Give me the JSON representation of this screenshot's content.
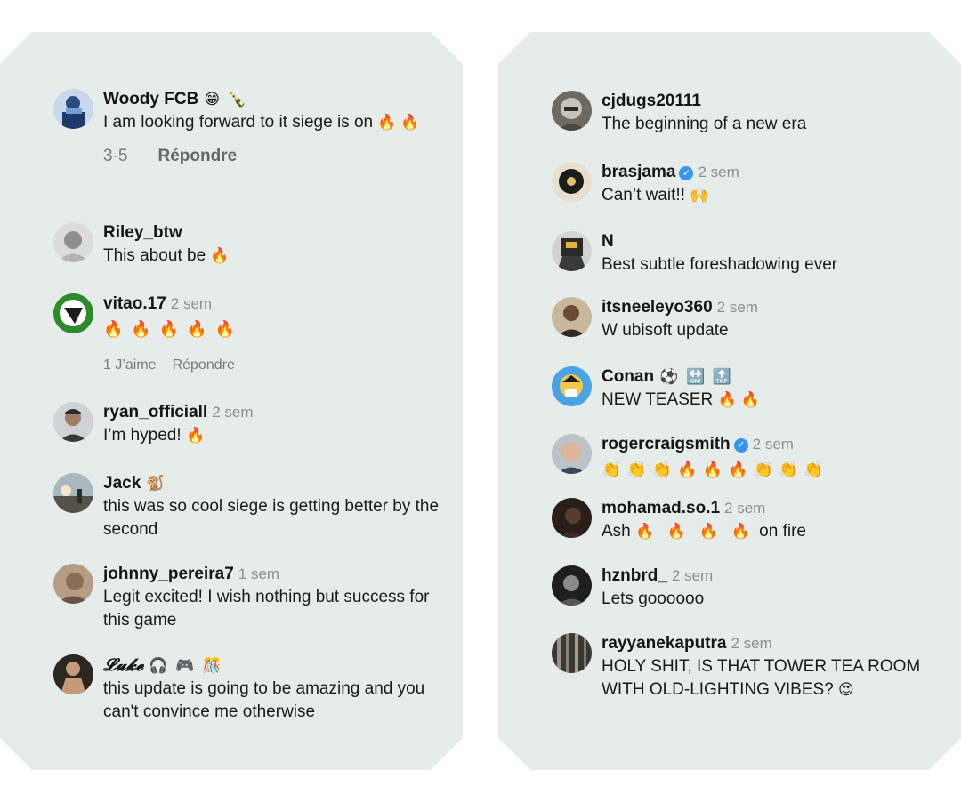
{
  "left_comments": [
    {
      "user": "Woody FCB",
      "time": "",
      "emojis": "😁 🍾",
      "text": "I am looking forward to it siege is on",
      "text_emoji": "🔥 🔥",
      "actions": {
        "date": "3-5",
        "reply": "Répondre"
      }
    },
    {
      "user": "Riley_btw",
      "time": "",
      "emojis": "",
      "text": "This about be",
      "text_emoji": "🔥"
    },
    {
      "user": "vitao.17",
      "time": "2 sem",
      "emojis": "",
      "text": "",
      "text_emoji": "🔥🔥🔥🔥🔥",
      "actions": {
        "likes": "1 J’aime",
        "reply": "Répondre"
      }
    },
    {
      "user": "ryan_officiall",
      "time": "2 sem",
      "emojis": "",
      "text": "I’m hyped!",
      "text_emoji": "🔥"
    },
    {
      "user": "Jack",
      "time": "",
      "emojis": "🐒",
      "text": "this was so cool siege is getting better by the second",
      "text_emoji": ""
    },
    {
      "user": "johnny_pereira7",
      "time": "1 sem",
      "emojis": "",
      "text": "Legit excited! I wish nothing but success for this game",
      "text_emoji": ""
    },
    {
      "user": "𝓛𝓾𝓴𝓮",
      "time": "",
      "emojis": "🎧 🎮 🎊",
      "text": "this update is going to be amazing and you can't convince me otherwise",
      "text_emoji": ""
    }
  ],
  "right_comments": [
    {
      "user": "cjdugs20111",
      "time": "",
      "emojis": "",
      "text": "The beginning of a new era",
      "text_emoji": ""
    },
    {
      "user": "brasjama",
      "time": "2 sem",
      "emojis": "",
      "verified": "✓",
      "text": "Can’t wait!!",
      "text_emoji": "🙌"
    },
    {
      "user": "N",
      "time": "",
      "emojis": "",
      "text": "Best subtle foreshadowing ever",
      "text_emoji": ""
    },
    {
      "user": "itsneeleyo360",
      "time": "2 sem",
      "emojis": "",
      "text": "W ubisoft update",
      "text_emoji": ""
    },
    {
      "user": "Conan",
      "time": "",
      "emojis": "⚽ 🔛 🔝",
      "text": "NEW TEASER",
      "text_emoji": "🔥 🔥"
    },
    {
      "user": "rogercraigsmith",
      "time": "2 sem",
      "emojis": "",
      "verified": "✓",
      "text": "",
      "text_emoji": "👏👏👏🔥🔥🔥👏👏👏"
    },
    {
      "user": "mohamad.so.1",
      "time": "2 sem",
      "emojis": "",
      "text": "Ash",
      "text_emoji": "🔥 🔥 🔥 🔥",
      "text_after": "on fire"
    },
    {
      "user": "hznbrd_",
      "time": "2 sem",
      "emojis": "",
      "text": "Lets goooooo",
      "text_emoji": ""
    },
    {
      "user": "rayyanekaputra",
      "time": "2 sem",
      "emojis": "",
      "text": "HOLY SHIT, IS THAT TOWER TEA ROOM WITH OLD-LIGHTING VIBES?",
      "text_emoji": "😍"
    }
  ],
  "colors": {
    "panel": "#e5ecea",
    "muted": "#8a8f92",
    "verified": "#3797f0",
    "fire": "#f28a1e"
  }
}
